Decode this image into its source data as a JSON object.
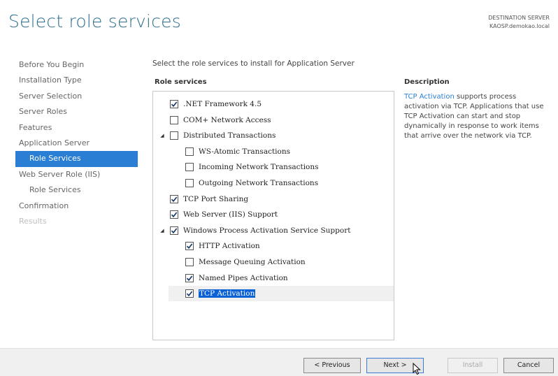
{
  "page_title": "Select role services",
  "destination": {
    "label": "DESTINATION SERVER",
    "server": "KAOSP.demokao.local"
  },
  "nav": [
    {
      "label": "Before You Begin",
      "state": "normal"
    },
    {
      "label": "Installation Type",
      "state": "normal"
    },
    {
      "label": "Server Selection",
      "state": "normal"
    },
    {
      "label": "Server Roles",
      "state": "normal"
    },
    {
      "label": "Features",
      "state": "normal"
    },
    {
      "label": "Application Server",
      "state": "normal"
    },
    {
      "label": "Role Services",
      "state": "active"
    },
    {
      "label": "Web Server Role (IIS)",
      "state": "normal"
    },
    {
      "label": "Role Services",
      "state": "sub"
    },
    {
      "label": "Confirmation",
      "state": "normal"
    },
    {
      "label": "Results",
      "state": "disabled"
    }
  ],
  "instruction": "Select the role services to install for Application Server",
  "role_services_header": "Role services",
  "description_header": "Description",
  "role_services": [
    {
      "label": ".NET Framework 4.5",
      "checked": true,
      "level": 0,
      "expander": false
    },
    {
      "label": "COM+ Network Access",
      "checked": false,
      "level": 0,
      "expander": false
    },
    {
      "label": "Distributed Transactions",
      "checked": false,
      "level": 0,
      "expander": true
    },
    {
      "label": "WS-Atomic Transactions",
      "checked": false,
      "level": 1,
      "expander": false
    },
    {
      "label": "Incoming Network Transactions",
      "checked": false,
      "level": 1,
      "expander": false
    },
    {
      "label": "Outgoing Network Transactions",
      "checked": false,
      "level": 1,
      "expander": false
    },
    {
      "label": "TCP Port Sharing",
      "checked": true,
      "level": 0,
      "expander": false
    },
    {
      "label": "Web Server (IIS) Support",
      "checked": true,
      "level": 0,
      "expander": false
    },
    {
      "label": "Windows Process Activation Service Support",
      "checked": true,
      "level": 0,
      "expander": true
    },
    {
      "label": "HTTP Activation",
      "checked": true,
      "level": 1,
      "expander": false
    },
    {
      "label": "Message Queuing Activation",
      "checked": false,
      "level": 1,
      "expander": false
    },
    {
      "label": "Named Pipes Activation",
      "checked": true,
      "level": 1,
      "expander": false
    },
    {
      "label": "TCP Activation",
      "checked": true,
      "level": 1,
      "expander": false,
      "selected": true
    }
  ],
  "description": {
    "link": "TCP Activation",
    "text": " supports process activation via TCP. Applications that use TCP Activation can start and stop dynamically in response to work items that arrive over the network via TCP."
  },
  "buttons": {
    "previous": "< Previous",
    "next": "Next >",
    "install": "Install",
    "cancel": "Cancel"
  },
  "icons": {
    "checkbox_checked": "checkmark-icon",
    "expander": "expand-triangle-icon",
    "cursor": "mouse-pointer-icon"
  }
}
